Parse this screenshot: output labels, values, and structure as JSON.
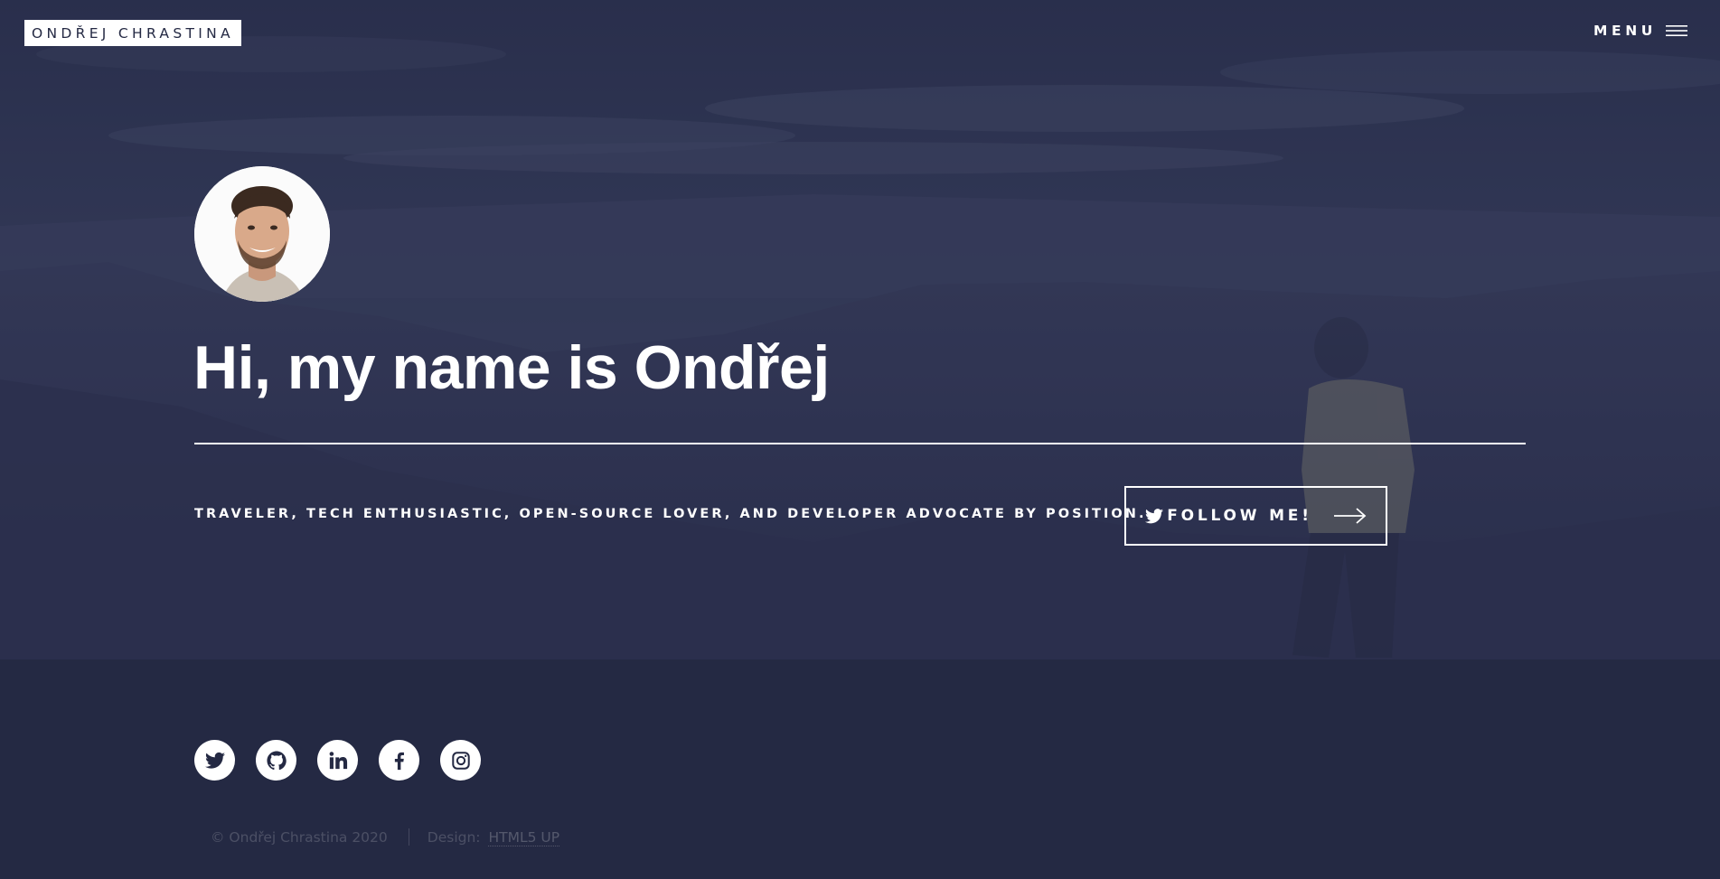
{
  "header": {
    "logo_text": "ONDŘEJ CHRASTINA",
    "menu_label": "MENU"
  },
  "hero": {
    "title": "Hi, my name is Ondřej",
    "tagline": "TRAVELER, TECH ENTHUSIASTIC, OPEN-SOURCE LOVER, AND DEVELOPER ADVOCATE BY POSITION.",
    "follow_button": {
      "label": "FOLLOW ME!",
      "icon": "twitter-icon",
      "trailing_icon": "arrow-right-icon"
    },
    "avatar_icon": "profile-photo"
  },
  "footer": {
    "social": [
      {
        "name": "Twitter",
        "icon": "twitter-icon"
      },
      {
        "name": "GitHub",
        "icon": "github-icon"
      },
      {
        "name": "LinkedIn",
        "icon": "linkedin-icon"
      },
      {
        "name": "Facebook",
        "icon": "facebook-icon"
      },
      {
        "name": "Instagram",
        "icon": "instagram-icon"
      }
    ],
    "copyright": "© Ondřej Chrastina 2020",
    "design_label": "Design:",
    "design_link": "HTML5 UP"
  },
  "colors": {
    "background": "#242943",
    "accent": "#ffffff"
  }
}
